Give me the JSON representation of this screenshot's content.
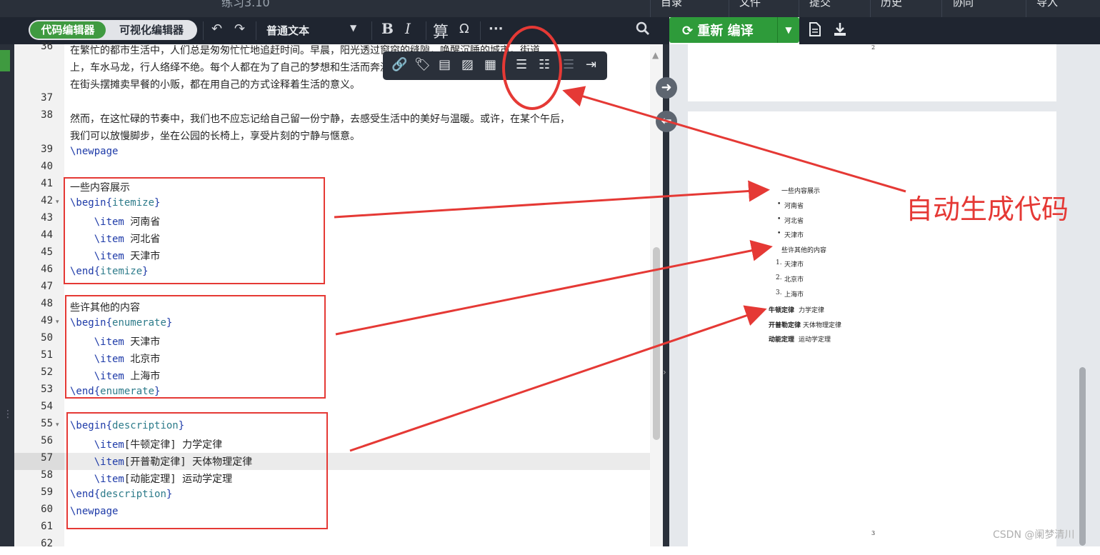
{
  "topbar": {
    "title": "练习3.10",
    "items": [
      "目录",
      "文件",
      "提交",
      "历史",
      "协同",
      "导入"
    ]
  },
  "toolbar": {
    "mode_code": "代码编辑器",
    "mode_visual": "可视化编辑器",
    "style_select": "普通文本",
    "bold": "B",
    "italic": "I",
    "math": "算",
    "omega": "Ω",
    "more": "···",
    "compile": "重新 编译",
    "icons": [
      "undo-icon",
      "redo-icon",
      "search-icon",
      "document-icon",
      "download-icon"
    ]
  },
  "float_toolbar": {
    "icons": [
      "link-icon",
      "tag-icon",
      "book-icon",
      "image-icon",
      "table-icon",
      "bullet-list-icon",
      "numbered-list-icon",
      "outdent-icon",
      "indent-icon"
    ]
  },
  "editor": {
    "lines": [
      {
        "n": "36",
        "fold": "",
        "text": "在繁忙的都市生活中，人们总是匆匆忙忙地追赶时间。早晨，阳光透过窗帘的缝隙，唤醒沉睡的城市。街道"
      },
      {
        "n": "",
        "fold": "",
        "text": "上，车水马龙，行人络绎不绝。每个人都在为了自己的梦想和生活而奔波，无论是在写字楼里忙碌的白领，还是"
      },
      {
        "n": "",
        "fold": "",
        "text": "在街头摆摊卖早餐的小贩，都在用自己的方式诠释着生活的意义。"
      },
      {
        "n": "37",
        "fold": "",
        "text": ""
      },
      {
        "n": "38",
        "fold": "",
        "text": "然而，在这忙碌的节奏中，我们也不应忘记给自己留一份宁静，去感受生活中的美好与温暖。或许，在某个午后，"
      },
      {
        "n": "",
        "fold": "",
        "text": "我们可以放慢脚步，坐在公园的长椅上，享受片刻的宁静与惬意。"
      },
      {
        "n": "39",
        "fold": "",
        "text": "\\newpage"
      },
      {
        "n": "40",
        "fold": "",
        "text": ""
      },
      {
        "n": "41",
        "fold": "",
        "text": "一些内容展示"
      },
      {
        "n": "42",
        "fold": "▾",
        "text": "\\begin{itemize}"
      },
      {
        "n": "43",
        "fold": "",
        "text": "    \\item 河南省"
      },
      {
        "n": "44",
        "fold": "",
        "text": "    \\item 河北省"
      },
      {
        "n": "45",
        "fold": "",
        "text": "    \\item 天津市"
      },
      {
        "n": "46",
        "fold": "",
        "text": "\\end{itemize}"
      },
      {
        "n": "47",
        "fold": "",
        "text": ""
      },
      {
        "n": "48",
        "fold": "",
        "text": "些许其他的内容"
      },
      {
        "n": "49",
        "fold": "▾",
        "text": "\\begin{enumerate}"
      },
      {
        "n": "50",
        "fold": "",
        "text": "    \\item 天津市"
      },
      {
        "n": "51",
        "fold": "",
        "text": "    \\item 北京市"
      },
      {
        "n": "52",
        "fold": "",
        "text": "    \\item 上海市"
      },
      {
        "n": "53",
        "fold": "",
        "text": "\\end{enumerate}"
      },
      {
        "n": "54",
        "fold": "",
        "text": ""
      },
      {
        "n": "55",
        "fold": "▾",
        "text": "\\begin{description}"
      },
      {
        "n": "56",
        "fold": "",
        "text": "    \\item[牛顿定律] 力学定律"
      },
      {
        "n": "57",
        "fold": "",
        "text": "    \\item[开普勒定律] 天体物理定律"
      },
      {
        "n": "58",
        "fold": "",
        "text": "    \\item[动能定理] 运动学定理"
      },
      {
        "n": "59",
        "fold": "",
        "text": "\\end{description}"
      },
      {
        "n": "60",
        "fold": "",
        "text": "\\newpage"
      },
      {
        "n": "61",
        "fold": "",
        "text": ""
      },
      {
        "n": "62",
        "fold": "",
        "text": ""
      }
    ]
  },
  "preview": {
    "page2_number": "2",
    "page3_number": "3",
    "heading1": "一些内容展示",
    "itemize": [
      "河南省",
      "河北省",
      "天津市"
    ],
    "heading2": "些许其他的内容",
    "enumerate": [
      "天津市",
      "北京市",
      "上海市"
    ],
    "description": [
      {
        "term": "牛顿定律",
        "desc": "力学定律"
      },
      {
        "term": "开普勒定律",
        "desc": "天体物理定律"
      },
      {
        "term": "动能定理",
        "desc": "运动学定理"
      }
    ]
  },
  "annotation": {
    "callout": "自动生成代码",
    "color": "#e53935"
  },
  "watermark": "CSDN @阑梦清川"
}
